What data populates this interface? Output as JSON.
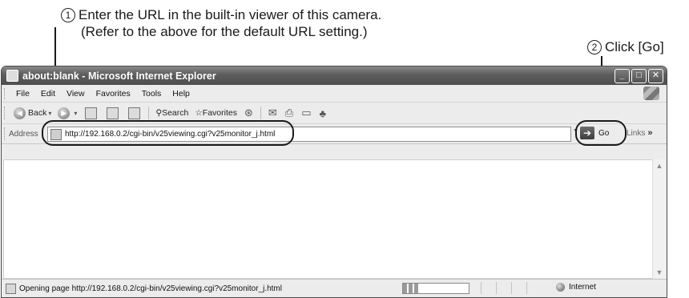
{
  "callouts": {
    "step1": {
      "number": "1",
      "line1": "Enter the URL in the built-in viewer of this camera.",
      "line2": "(Refer to the above for the default URL setting.)"
    },
    "step2": {
      "number": "2",
      "text": "Click [Go]"
    }
  },
  "window": {
    "title": "about:blank - Microsoft Internet Explorer",
    "buttons": {
      "minimize": "_",
      "maximize": "□",
      "close": "✕"
    }
  },
  "menu": [
    "File",
    "Edit",
    "View",
    "Favorites",
    "Tools",
    "Help"
  ],
  "toolbar": {
    "back": "Back",
    "search": "Search",
    "favorites": "Favorites"
  },
  "address": {
    "label": "Address",
    "url": "http://192.168.0.2/cgi-bin/v25viewing.cgi?v25monitor_j.html",
    "go": "Go",
    "links": "Links"
  },
  "status": {
    "text": "Opening page http://192.168.0.2/cgi-bin/v25viewing.cgi?v25monitor_j.html",
    "progress": 0.26,
    "zone": "Internet"
  },
  "icons": [
    "app-icon",
    "windows-logo",
    "back-icon",
    "forward-icon",
    "stop-icon",
    "refresh-icon",
    "home-icon",
    "search-icon",
    "favorites-icon",
    "history-icon",
    "mail-icon",
    "print-icon",
    "edit-icon",
    "messenger-icon",
    "page-icon",
    "go-arrow-icon",
    "globe-icon"
  ]
}
